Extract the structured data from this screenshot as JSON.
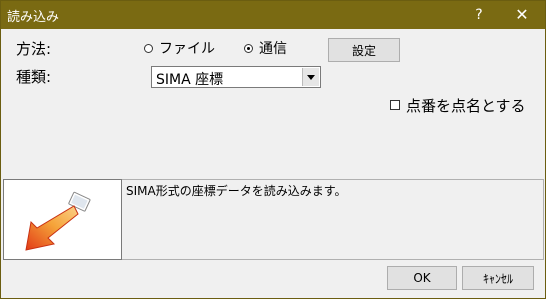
{
  "window": {
    "title": "読み込み",
    "help_glyph": "?",
    "close_glyph": "✕"
  },
  "method": {
    "label": "方法:",
    "options": [
      {
        "label": "ファイル",
        "selected": false
      },
      {
        "label": "通信",
        "selected": true
      }
    ],
    "settings_button": "設定"
  },
  "type": {
    "label": "種類:",
    "selected_value": "SIMA 座標"
  },
  "checkbox": {
    "label": "点番を点名とする",
    "checked": false
  },
  "description": {
    "text": "SIMA形式の座標データを読み込みます。",
    "icon": "import-arrow-icon"
  },
  "buttons": {
    "ok": "OK",
    "cancel": "ｷｬﾝｾﾙ"
  },
  "colors": {
    "titlebar": "#7a6a12",
    "arrow_red": "#e8401c",
    "arrow_orange": "#f5a43a"
  }
}
